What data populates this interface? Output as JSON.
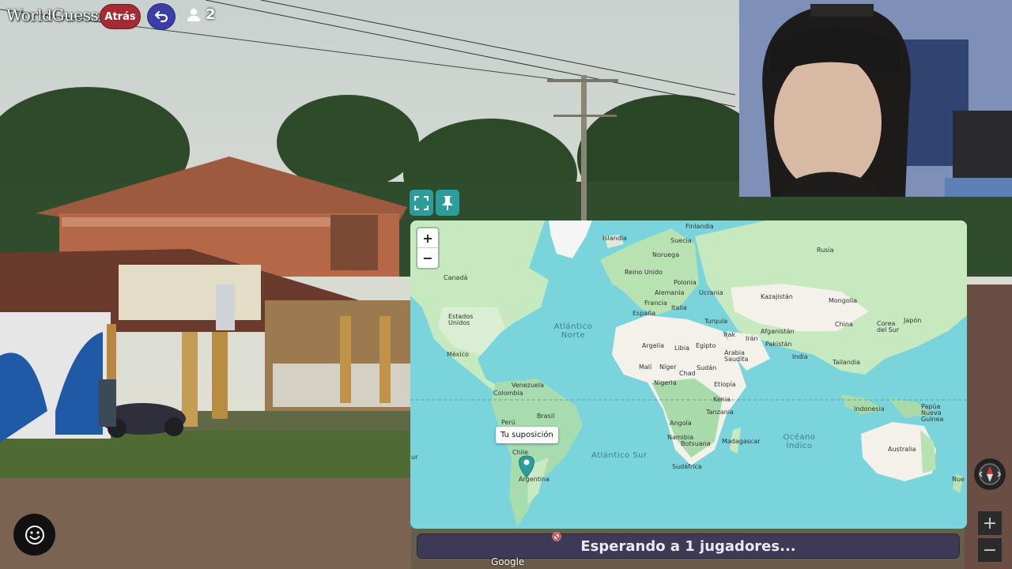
{
  "app": {
    "logo": "WorldGuessr"
  },
  "topbar": {
    "back_label": "Atrás",
    "player_count": "2"
  },
  "map": {
    "zoom_in": "+",
    "zoom_out": "−",
    "guess_tooltip": "Tu suposición",
    "countries": [
      "Islandia",
      "Finlandia",
      "Suecia",
      "Noruega",
      "Rusia",
      "Reino Unido",
      "Polonia",
      "Alemania",
      "Ucrania",
      "Francia",
      "Italia",
      "España",
      "Kazajistán",
      "Mongolia",
      "Turquía",
      "Afganistán",
      "China",
      "Corea del Sur",
      "Japón",
      "Irak",
      "Irán",
      "Pakistán",
      "Argelia",
      "Libia",
      "Egipto",
      "Arabia Saudita",
      "India",
      "Malí",
      "Níger",
      "Chad",
      "Sudán",
      "Tailandia",
      "Nigeria",
      "Etiopía",
      "Kenia",
      "Indonesia",
      "Tanzania",
      "Papúa Nueva Guinea",
      "Angola",
      "Namibia",
      "Madagascar",
      "Botsuana",
      "Sudáfrica",
      "Australia",
      "Canadá",
      "Estados Unidos",
      "México",
      "Venezuela",
      "Colombia",
      "Brasil",
      "Perú",
      "Chile",
      "Argentina"
    ],
    "oceans": {
      "north_atlantic": "Atlántico Norte",
      "south_atlantic": "Atlántico Sur",
      "indian": "Océano Índico"
    },
    "edge_labels": {
      "left": "ur",
      "right": "Nue"
    }
  },
  "status": {
    "waiting": "Esperando a 1 jugadores..."
  },
  "attribution": "Google",
  "controls": {
    "zoom_in": "+",
    "zoom_out": "−"
  },
  "colors": {
    "map_water": "#79d4dc",
    "map_land": "#c7e9c0",
    "map_land_dry": "#f3f1ea",
    "back_button": "#a52a33",
    "return_button": "#3a3fa8",
    "map_tool": "#2a9d9c"
  }
}
